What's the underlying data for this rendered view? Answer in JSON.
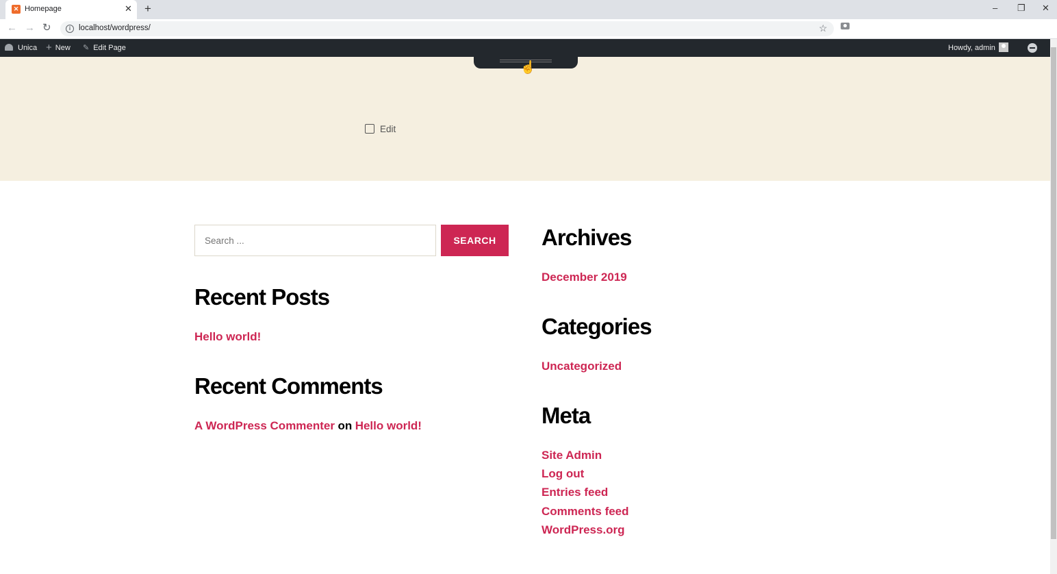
{
  "browser": {
    "tab_title": "Homepage",
    "favicon_text": "✕",
    "url": "localhost/wordpress/",
    "new_tab": "+",
    "close_tab": "✕",
    "minimize": "–",
    "restore": "❐",
    "close": "✕",
    "back": "←",
    "forward": "→",
    "reload": "↻",
    "star": "☆"
  },
  "adminbar": {
    "site_name": "Unica",
    "new_label": "New",
    "edit_page_label": "Edit Page",
    "howdy": "Howdy, admin"
  },
  "hero": {
    "edit_label": "Edit",
    "hand": "☝"
  },
  "search": {
    "placeholder": "Search ...",
    "button_label": "SEARCH"
  },
  "recent_posts": {
    "title": "Recent Posts",
    "items": [
      "Hello world!"
    ]
  },
  "recent_comments": {
    "title": "Recent Comments",
    "author": "A WordPress Commenter",
    "on": "on",
    "post": "Hello world!"
  },
  "archives": {
    "title": "Archives",
    "items": [
      "December 2019"
    ]
  },
  "categories": {
    "title": "Categories",
    "items": [
      "Uncategorized"
    ]
  },
  "meta": {
    "title": "Meta",
    "items": [
      "Site Admin",
      "Log out",
      "Entries feed",
      "Comments feed",
      "WordPress.org"
    ]
  },
  "colors": {
    "accent": "#cd2653",
    "hero_bg": "#f5efe0",
    "adminbar_bg": "#23282d"
  }
}
